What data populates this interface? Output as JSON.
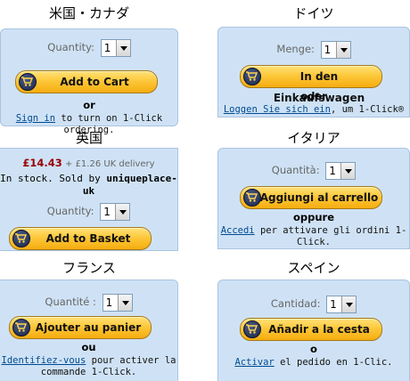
{
  "panels": {
    "us": {
      "title": "米国・カナダ",
      "quantity_label": "Quantity:",
      "quantity_value": "1",
      "button_label": "Add to Cart",
      "or_text": "or",
      "signin_link": "Sign in",
      "signin_rest": " to turn on 1-Click ordering."
    },
    "de": {
      "title": "ドイツ",
      "quantity_label": "Menge:",
      "quantity_value": "1",
      "button_label": "In den Einkaufswagen",
      "or_text": "oder",
      "signin_link": "Loggen Sie sich ein",
      "signin_rest": ", um 1-Click®"
    },
    "uk": {
      "title": "英国",
      "price": "£14.43",
      "delivery": " + £1.26 UK delivery",
      "stock_text": "In stock. Sold by ",
      "seller": "uniqueplace-uk",
      "quantity_label": "Quantity:",
      "quantity_value": "1",
      "button_label": "Add to Basket"
    },
    "it": {
      "title": "イタリア",
      "quantity_label": "Quantità:",
      "quantity_value": "1",
      "button_label": "Aggiungi al carrello",
      "or_text": "oppure",
      "signin_link": "Accedi",
      "signin_rest_line1": " per attivare gli ordini 1-",
      "signin_rest_line2": "Click."
    },
    "fr": {
      "title": "フランス",
      "quantity_label": "Quantité :",
      "quantity_value": "1",
      "button_label": "Ajouter au panier",
      "or_text": "ou",
      "signin_link": "Identifiez-vous",
      "signin_rest_line1": " pour activer la",
      "signin_rest_line2": "commande 1-Click."
    },
    "es": {
      "title": "スペイン",
      "quantity_label": "Cantidad:",
      "quantity_value": "1",
      "button_label": "Añadir a la cesta",
      "or_text": "o",
      "signin_link": "Activar",
      "signin_rest": " el pedido en 1-Clic."
    }
  }
}
